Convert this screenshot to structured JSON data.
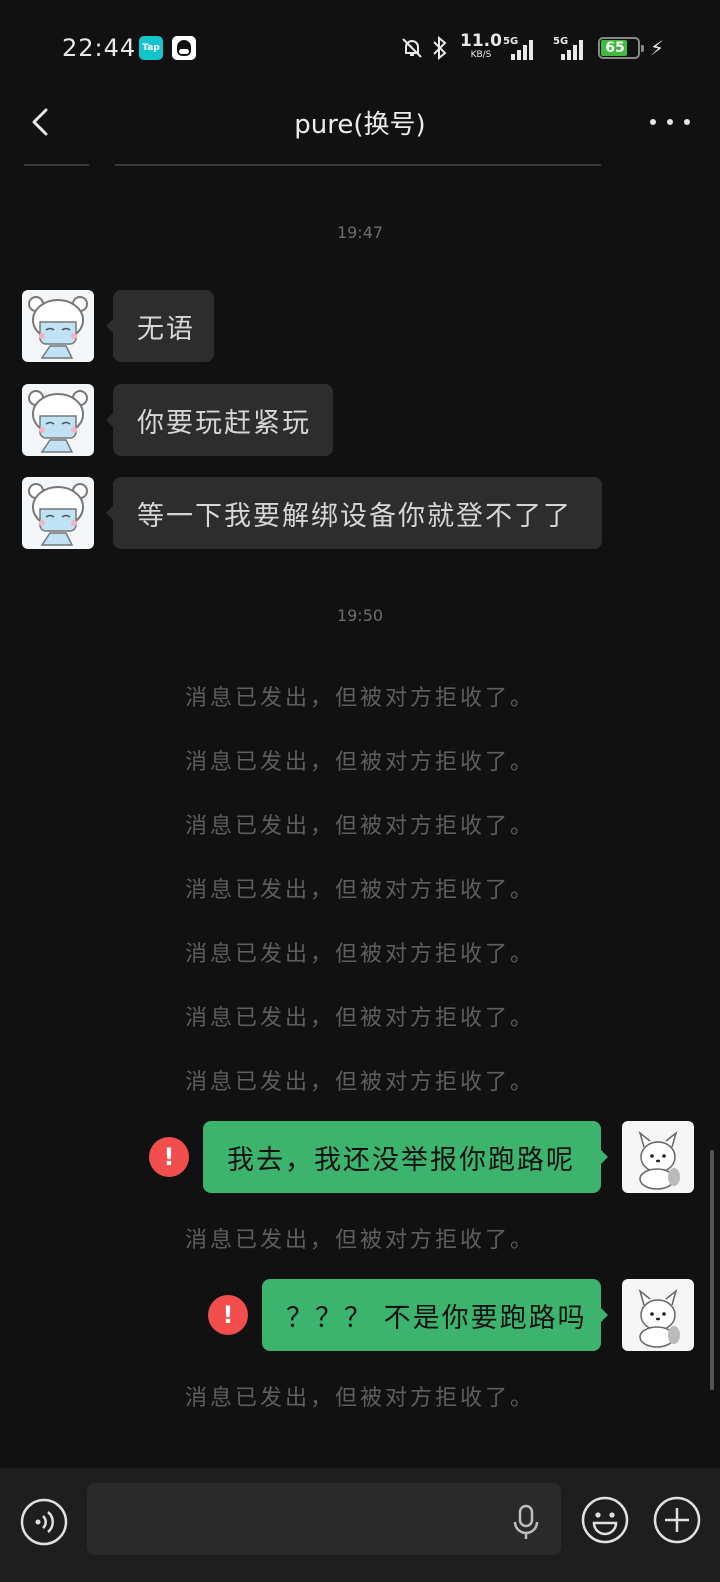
{
  "status_bar": {
    "time": "22:44",
    "apps": [
      "Tap"
    ],
    "net_speed": "11.0",
    "net_unit": "KB/S",
    "sim1": "5G",
    "sim2": "5G",
    "battery": "65"
  },
  "header": {
    "title": "pure(换号)"
  },
  "messages": {
    "ts1": "19:47",
    "in1": "无语",
    "in2": "你要玩赶紧玩",
    "in3": "等一下我要解绑设备你就登不了了",
    "ts2": "19:50",
    "rejected": "消息已发出，但被对方拒收了。",
    "out1": "我去，我还没举报你跑路呢",
    "out2": "？？？ 不是你要跑路吗",
    "fail_mark": "!"
  },
  "colors": {
    "background": "#111111",
    "incoming_bubble": "#2d2d2d",
    "outgoing_bubble": "#3cb46e",
    "fail_red": "#f24e4e"
  },
  "icons": [
    "back-icon",
    "more-icon",
    "voice-icon",
    "microphone-icon",
    "emoji-icon",
    "plus-icon",
    "mute-icon",
    "bluetooth-icon",
    "charging-icon"
  ]
}
